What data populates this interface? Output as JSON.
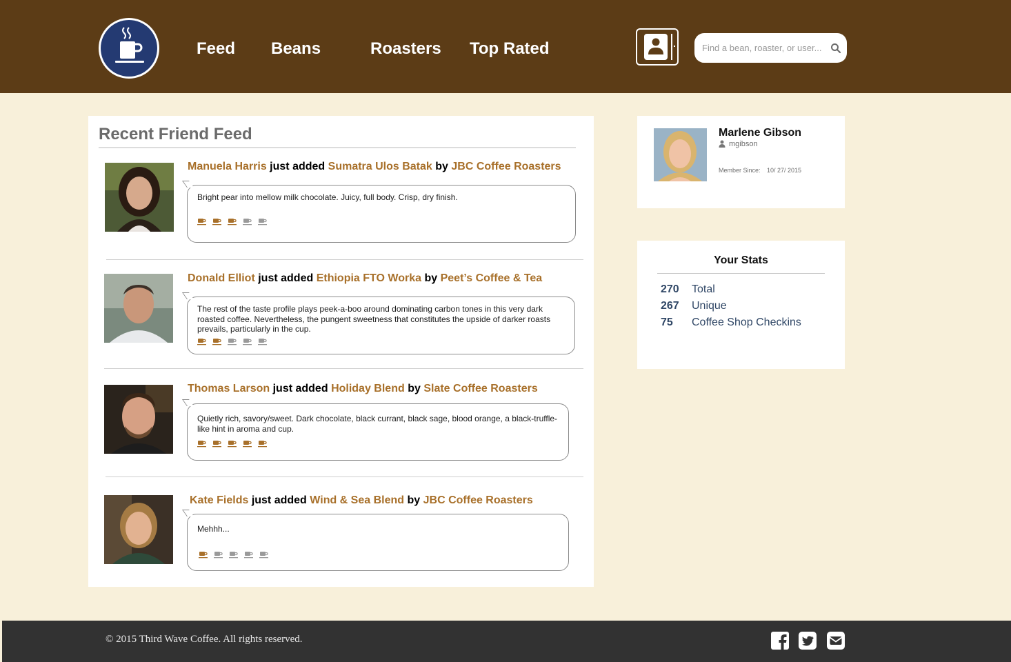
{
  "nav": {
    "items": [
      {
        "label": "Feed"
      },
      {
        "label": "Beans"
      },
      {
        "label": "Roasters"
      },
      {
        "label": "Top Rated"
      }
    ]
  },
  "search": {
    "placeholder": "Find a bean, roaster, or user..."
  },
  "feed": {
    "title": "Recent Friend Feed",
    "entries": [
      {
        "user": "Manuela Harris",
        "action": "just added",
        "bean": "Sumatra Ulos Batak",
        "by": "by",
        "roaster": "JBC Coffee Roasters",
        "review": "Bright pear into mellow milk chocolate. Juicy, full body. Crisp, dry finish.",
        "rating": 3,
        "rating_max": 5
      },
      {
        "user": "Donald Elliot",
        "action": "just added",
        "bean": "Ethiopia FTO Worka",
        "by": "by",
        "roaster": "Peet’s Coffee & Tea",
        "review": "The rest of the taste profile plays peek-a-boo around dominating carbon tones in this very dark roasted coffee. Nevertheless, the pungent sweetness that constitutes the upside of darker roasts prevails, particularly in the cup.",
        "rating": 2,
        "rating_max": 5
      },
      {
        "user": "Thomas Larson",
        "action": "just added",
        "bean": "Holiday Blend",
        "by": "by",
        "roaster": "Slate Coffee Roasters",
        "review": "Quietly rich, savory/sweet. Dark chocolate, black currant, black sage, blood orange, a black-truffle-like hint in aroma and cup.",
        "rating": 5,
        "rating_max": 5
      },
      {
        "user": "Kate Fields",
        "action": "just added",
        "bean": "Wind & Sea Blend",
        "by": "by",
        "roaster": "JBC Coffee Roasters",
        "review": "Mehhh...",
        "rating": 1,
        "rating_max": 5
      }
    ]
  },
  "profile": {
    "name": "Marlene Gibson",
    "username": "mgibson",
    "member_since_label": "Member Since:",
    "member_since": "10/ 27/ 2015"
  },
  "stats": {
    "title": "Your Stats",
    "items": [
      {
        "value": "270",
        "label": "Total"
      },
      {
        "value": "267",
        "label": "Unique"
      },
      {
        "value": "75",
        "label": "Coffee Shop Checkins"
      }
    ]
  },
  "footer": {
    "copyright": "© 2015 Third Wave Coffee. All rights reserved.",
    "social_icons": [
      "facebook-icon",
      "twitter-icon",
      "email-icon"
    ]
  },
  "colors": {
    "header_bg": "#5c3c16",
    "page_bg": "#f8f0da",
    "link": "#a8702a",
    "logo_blue": "#243a72",
    "stats_text": "#304766",
    "footer_bg": "#323232",
    "cup_active": "#a8702a",
    "cup_inactive": "#9a9a9a"
  }
}
